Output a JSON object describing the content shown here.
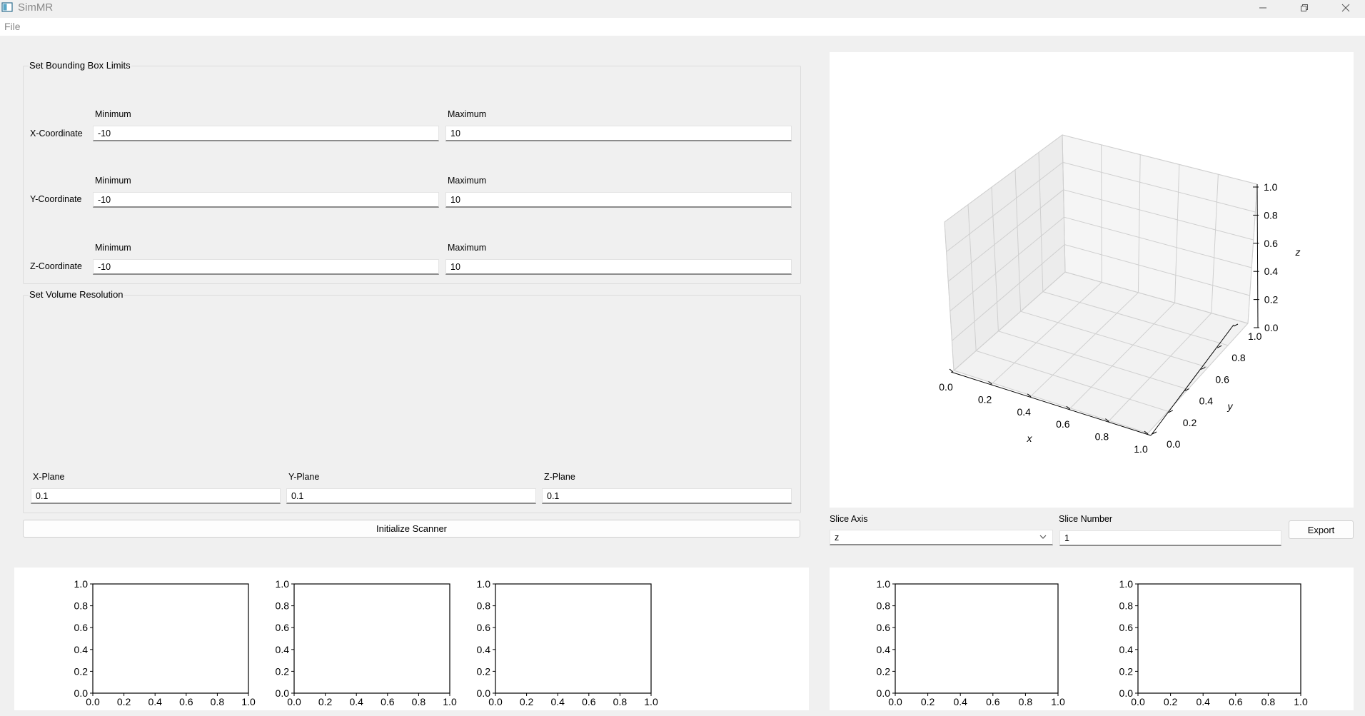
{
  "window": {
    "title": "SimMR"
  },
  "menu": {
    "file": "File"
  },
  "bbox": {
    "title": "Set Bounding Box Limits",
    "min_label": "Minimum",
    "max_label": "Maximum",
    "rows": [
      {
        "label": "X-Coordinate",
        "min": "-10",
        "max": "10"
      },
      {
        "label": "Y-Coordinate",
        "min": "-10",
        "max": "10"
      },
      {
        "label": "Z-Coordinate",
        "min": "-10",
        "max": "10"
      }
    ]
  },
  "resolution": {
    "title": "Set Volume Resolution",
    "planes": [
      {
        "label": "X-Plane",
        "value": "0.1"
      },
      {
        "label": "Y-Plane",
        "value": "0.1"
      },
      {
        "label": "Z-Plane",
        "value": "0.1"
      }
    ]
  },
  "init_button": "Initialize Scanner",
  "slice": {
    "axis_label": "Slice Axis",
    "axis_value": "z",
    "number_label": "Slice Number",
    "number_value": "1",
    "export_label": "Export"
  },
  "plot3d": {
    "xlabel": "x",
    "ylabel": "y",
    "zlabel": "z",
    "x_ticks": [
      "0.0",
      "0.2",
      "0.4",
      "0.6",
      "0.8",
      "1.0"
    ],
    "y_ticks": [
      "0.0",
      "0.2",
      "0.4",
      "0.6",
      "0.8",
      "1.0"
    ],
    "z_ticks": [
      "0.0",
      "0.2",
      "0.4",
      "0.6",
      "0.8",
      "1.0"
    ]
  },
  "chart_data": [
    {
      "type": "line",
      "series": [],
      "xlim": [
        0,
        1
      ],
      "ylim": [
        0,
        1
      ],
      "x_ticks": [
        "0.0",
        "0.2",
        "0.4",
        "0.6",
        "0.8",
        "1.0"
      ],
      "y_ticks": [
        "0.0",
        "0.2",
        "0.4",
        "0.6",
        "0.8",
        "1.0"
      ]
    },
    {
      "type": "line",
      "series": [],
      "xlim": [
        0,
        1
      ],
      "ylim": [
        0,
        1
      ],
      "x_ticks": [
        "0.0",
        "0.2",
        "0.4",
        "0.6",
        "0.8",
        "1.0"
      ],
      "y_ticks": [
        "0.0",
        "0.2",
        "0.4",
        "0.6",
        "0.8",
        "1.0"
      ]
    },
    {
      "type": "line",
      "series": [],
      "xlim": [
        0,
        1
      ],
      "ylim": [
        0,
        1
      ],
      "x_ticks": [
        "0.0",
        "0.2",
        "0.4",
        "0.6",
        "0.8",
        "1.0"
      ],
      "y_ticks": [
        "0.0",
        "0.2",
        "0.4",
        "0.6",
        "0.8",
        "1.0"
      ]
    },
    {
      "type": "line",
      "series": [],
      "xlim": [
        0,
        1
      ],
      "ylim": [
        0,
        1
      ],
      "x_ticks": [
        "0.0",
        "0.2",
        "0.4",
        "0.6",
        "0.8",
        "1.0"
      ],
      "y_ticks": [
        "0.0",
        "0.2",
        "0.4",
        "0.6",
        "0.8",
        "1.0"
      ]
    },
    {
      "type": "line",
      "series": [],
      "xlim": [
        0,
        1
      ],
      "ylim": [
        0,
        1
      ],
      "x_ticks": [
        "0.0",
        "0.2",
        "0.4",
        "0.6",
        "0.8",
        "1.0"
      ],
      "y_ticks": [
        "0.0",
        "0.2",
        "0.4",
        "0.6",
        "0.8",
        "1.0"
      ]
    }
  ]
}
